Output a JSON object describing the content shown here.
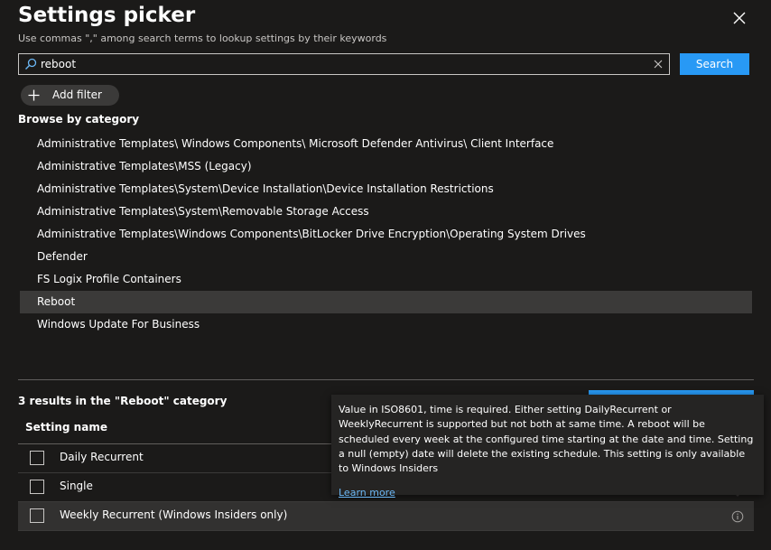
{
  "header": {
    "title": "Settings picker",
    "subtitle": "Use commas \",\" among search terms to lookup settings by their keywords"
  },
  "search": {
    "value": "reboot",
    "button_label": "Search"
  },
  "filter": {
    "add_label": "Add filter"
  },
  "browse": {
    "heading": "Browse by category",
    "categories": [
      {
        "label": "Administrative Templates\\ Windows Components\\ Microsoft Defender Antivirus\\ Client Interface"
      },
      {
        "label": "Administrative Templates\\MSS (Legacy)"
      },
      {
        "label": "Administrative Templates\\System\\Device Installation\\Device Installation Restrictions"
      },
      {
        "label": "Administrative Templates\\System\\Removable Storage Access"
      },
      {
        "label": "Administrative Templates\\Windows Components\\BitLocker Drive Encryption\\Operating System Drives"
      },
      {
        "label": "Defender"
      },
      {
        "label": "FS Logix Profile Containers"
      },
      {
        "label": "Reboot",
        "selected": true
      },
      {
        "label": "Windows Update For Business"
      }
    ]
  },
  "results": {
    "summary": "3 results in the \"Reboot\" category",
    "column_header": "Setting name",
    "rows": [
      {
        "label": "Daily Recurrent",
        "checked": false
      },
      {
        "label": "Single",
        "checked": false
      },
      {
        "label": "Weekly Recurrent (Windows Insiders only)",
        "checked": false
      }
    ]
  },
  "tooltip": {
    "text": "Value in ISO8601, time is required. Either setting DailyRecurrent or WeeklyRecurrent is supported but not both at same time. A reboot will be scheduled every week at the configured time starting at the date and time. Setting a null (empty) date will delete the existing schedule. This setting is only available to Windows Insiders",
    "link_label": "Learn more"
  },
  "colors": {
    "background": "#1b1a19",
    "accent": "#2899f5",
    "link": "#6cb8f6",
    "selected_row": "#3b3a39"
  },
  "icons": {
    "close": "close-icon",
    "search": "search-icon",
    "clear": "clear-icon",
    "add": "plus-icon",
    "info": "info-icon"
  }
}
